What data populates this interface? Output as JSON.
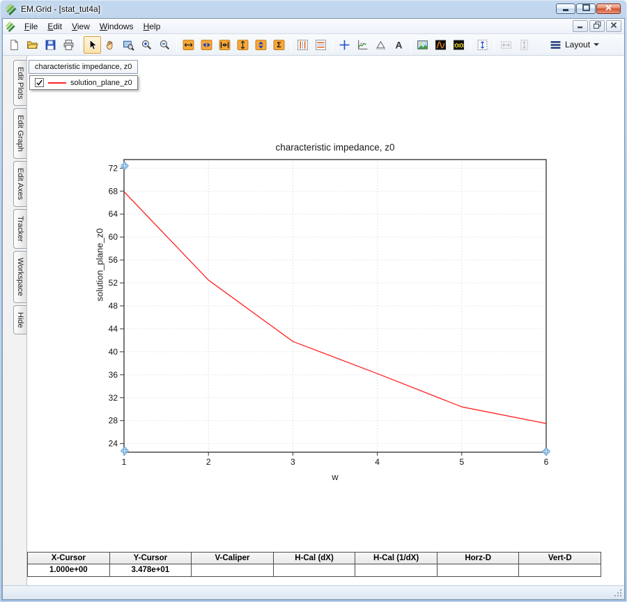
{
  "window": {
    "title": "EM.Grid - [stat_tut4a]",
    "controls": [
      {
        "name": "minimize-button"
      },
      {
        "name": "maximize-button"
      },
      {
        "name": "close-button"
      }
    ]
  },
  "menu": {
    "items": [
      "File",
      "Edit",
      "View",
      "Windows",
      "Help"
    ]
  },
  "mdi_controls": [
    {
      "name": "mdi-minimize-button"
    },
    {
      "name": "mdi-restore-button"
    },
    {
      "name": "mdi-close-button"
    }
  ],
  "toolbar": {
    "layout": {
      "label": "Layout"
    },
    "buttons": [
      {
        "name": "new-file"
      },
      {
        "name": "open-file"
      },
      {
        "name": "save-file"
      },
      {
        "name": "print"
      },
      {
        "sep": true
      },
      {
        "name": "select-cursor",
        "active": true
      },
      {
        "name": "pan-hand"
      },
      {
        "name": "zoom-window"
      },
      {
        "name": "zoom-in"
      },
      {
        "name": "zoom-out"
      },
      {
        "sep": true
      },
      {
        "name": "fit-horizontal"
      },
      {
        "name": "pan-horizontal"
      },
      {
        "name": "center-horizontal"
      },
      {
        "name": "fit-vertical"
      },
      {
        "name": "pan-vertical"
      },
      {
        "name": "autoscale",
        "glyph": "Σ"
      },
      {
        "sep": true
      },
      {
        "name": "vertical-markers"
      },
      {
        "name": "horizontal-markers"
      },
      {
        "sep": true
      },
      {
        "name": "crosshair"
      },
      {
        "name": "tracker-curve"
      },
      {
        "name": "delta-marker"
      },
      {
        "name": "text-annotation",
        "glyph": "A"
      },
      {
        "sep": true
      },
      {
        "name": "snapshot"
      },
      {
        "name": "fft-view"
      },
      {
        "name": "multi-wave-view"
      },
      {
        "sep": true
      },
      {
        "name": "fit-page-vertical"
      },
      {
        "sep": true
      },
      {
        "name": "sync-horizontal",
        "disabled": true
      },
      {
        "name": "sync-vertical",
        "disabled": true
      }
    ]
  },
  "sidebar": {
    "tabs": [
      {
        "label": "Edit Plots"
      },
      {
        "label": "Edit Graph"
      },
      {
        "label": "Edit Axes"
      },
      {
        "label": "Tracker"
      },
      {
        "label": "Workspace"
      },
      {
        "label": "Hide"
      }
    ]
  },
  "document": {
    "tab": "characteristic impedance, z0"
  },
  "legend": {
    "checked": true,
    "label": "solution_plane_z0",
    "color": "#ff2222"
  },
  "chart_data": {
    "type": "line",
    "title": "characteristic impedance, z0",
    "xlabel": "w",
    "ylabel": "solution_plane_z0",
    "x": [
      1,
      2,
      3,
      4,
      5,
      6
    ],
    "series": [
      {
        "name": "solution_plane_z0",
        "color": "#ff2222",
        "values": [
          67.9,
          52.5,
          41.8,
          36.2,
          30.4,
          27.5
        ]
      }
    ],
    "xlim": [
      1,
      6
    ],
    "ylim": [
      22.5,
      73.5
    ],
    "xticks": [
      1,
      2,
      3,
      4,
      5,
      6
    ],
    "yticks": [
      24,
      28,
      32,
      36,
      40,
      44,
      48,
      52,
      56,
      60,
      64,
      68,
      72
    ],
    "grid": true,
    "legend_position": "floating top-left",
    "cursor_markers": [
      {
        "corner": "top-left",
        "x": 1
      },
      {
        "corner": "bottom-left",
        "x": 1
      },
      {
        "corner": "bottom-right",
        "x": 6
      }
    ]
  },
  "cursor_table": {
    "headers": [
      "X-Cursor",
      "Y-Cursor",
      "V-Caliper",
      "H-Cal (dX)",
      "H-Cal (1/dX)",
      "Horz-D",
      "Vert-D"
    ],
    "values": [
      "1.000e+00",
      "3.478e+01",
      "",
      "",
      "",
      "",
      ""
    ]
  }
}
